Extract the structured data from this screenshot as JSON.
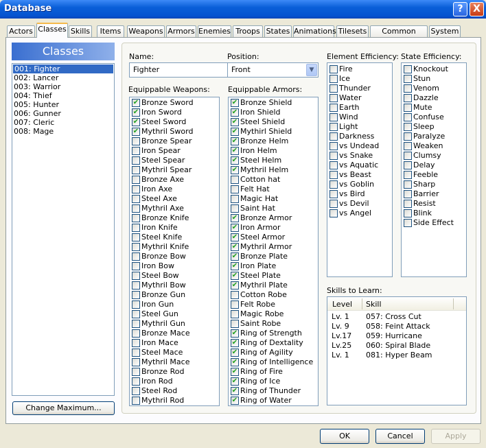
{
  "window": {
    "title": "Database",
    "help": "?",
    "close": "X"
  },
  "tabs": [
    "Actors",
    "Classes",
    "Skills",
    "Items",
    "Weapons",
    "Armors",
    "Enemies",
    "Troops",
    "States",
    "Animations",
    "Tilesets",
    "Common Events",
    "System"
  ],
  "selected_tab": "Classes",
  "classes": {
    "header": "Classes",
    "items": [
      "001: Fighter",
      "002: Lancer",
      "003: Warrior",
      "004: Thief",
      "005: Hunter",
      "006: Gunner",
      "007: Cleric",
      "008: Mage"
    ],
    "selected": 0,
    "change_max": "Change Maximum..."
  },
  "form": {
    "name_label": "Name:",
    "name_value": "Fighter",
    "position_label": "Position:",
    "position_value": "Front",
    "weapons_label": "Equippable Weapons:",
    "armors_label": "Equippable Armors:",
    "element_label": "Element Efficiency:",
    "state_label": "State Efficiency:",
    "skills_label": "Skills to Learn:"
  },
  "weapons": [
    [
      "Bronze Sword",
      true
    ],
    [
      "Iron Sword",
      true
    ],
    [
      "Steel Sword",
      true
    ],
    [
      "Mythril Sword",
      true
    ],
    [
      "Bronze Spear",
      false
    ],
    [
      "Iron Spear",
      false
    ],
    [
      "Steel Spear",
      false
    ],
    [
      "Mythril Spear",
      false
    ],
    [
      "Bronze Axe",
      false
    ],
    [
      "Iron Axe",
      false
    ],
    [
      "Steel Axe",
      false
    ],
    [
      "Mythril Axe",
      false
    ],
    [
      "Bronze Knife",
      false
    ],
    [
      "Iron Knife",
      false
    ],
    [
      "Steel Knife",
      false
    ],
    [
      "Mythril Knife",
      false
    ],
    [
      "Bronze Bow",
      false
    ],
    [
      "Iron Bow",
      false
    ],
    [
      "Steel Bow",
      false
    ],
    [
      "Mythril Bow",
      false
    ],
    [
      "Bronze Gun",
      false
    ],
    [
      "Iron Gun",
      false
    ],
    [
      "Steel Gun",
      false
    ],
    [
      "Mythril Gun",
      false
    ],
    [
      "Bronze Mace",
      false
    ],
    [
      "Iron Mace",
      false
    ],
    [
      "Steel Mace",
      false
    ],
    [
      "Mythril Mace",
      false
    ],
    [
      "Bronze Rod",
      false
    ],
    [
      "Iron Rod",
      false
    ],
    [
      "Steel Rod",
      false
    ],
    [
      "Mythril Rod",
      false
    ]
  ],
  "armors": [
    [
      "Bronze Shield",
      true
    ],
    [
      "Iron Shield",
      true
    ],
    [
      "Steel Shield",
      true
    ],
    [
      "Mythirl Shield",
      true
    ],
    [
      "Bronze Helm",
      true
    ],
    [
      "Iron Helm",
      true
    ],
    [
      "Steel Helm",
      true
    ],
    [
      "Mythril Helm",
      true
    ],
    [
      "Cotton hat",
      false
    ],
    [
      "Felt Hat",
      false
    ],
    [
      "Magic Hat",
      false
    ],
    [
      "Saint Hat",
      false
    ],
    [
      "Bronze Armor",
      true
    ],
    [
      "Iron Armor",
      true
    ],
    [
      "Steel Armor",
      true
    ],
    [
      "Mythril Armor",
      true
    ],
    [
      "Bronze Plate",
      true
    ],
    [
      "Iron Plate",
      true
    ],
    [
      "Steel Plate",
      true
    ],
    [
      "Mythril Plate",
      true
    ],
    [
      "Cotton Robe",
      false
    ],
    [
      "Felt Robe",
      false
    ],
    [
      "Magic Robe",
      false
    ],
    [
      "Saint Robe",
      false
    ],
    [
      "Ring of Strength",
      true
    ],
    [
      "Ring of Dextality",
      true
    ],
    [
      "Ring of Agility",
      true
    ],
    [
      "Ring of Intelligence",
      true
    ],
    [
      "Ring of Fire",
      true
    ],
    [
      "Ring of Ice",
      true
    ],
    [
      "Ring of Thunder",
      true
    ],
    [
      "Ring of Water",
      true
    ]
  ],
  "elements": [
    [
      "Fire",
      false
    ],
    [
      "Ice",
      false
    ],
    [
      "Thunder",
      false
    ],
    [
      "Water",
      false
    ],
    [
      "Earth",
      false
    ],
    [
      "Wind",
      false
    ],
    [
      "Light",
      false
    ],
    [
      "Darkness",
      false
    ],
    [
      "vs Undead",
      false
    ],
    [
      "vs Snake",
      false
    ],
    [
      "vs Aquatic",
      false
    ],
    [
      "vs Beast",
      false
    ],
    [
      "vs Goblin",
      false
    ],
    [
      "vs Bird",
      false
    ],
    [
      "vs Devil",
      false
    ],
    [
      "vs Angel",
      false
    ]
  ],
  "states": [
    [
      "Knockout",
      false
    ],
    [
      "Stun",
      false
    ],
    [
      "Venom",
      false
    ],
    [
      "Dazzle",
      false
    ],
    [
      "Mute",
      false
    ],
    [
      "Confuse",
      false
    ],
    [
      "Sleep",
      false
    ],
    [
      "Paralyze",
      false
    ],
    [
      "Weaken",
      false
    ],
    [
      "Clumsy",
      false
    ],
    [
      "Delay",
      false
    ],
    [
      "Feeble",
      false
    ],
    [
      "Sharp",
      false
    ],
    [
      "Barrier",
      false
    ],
    [
      "Resist",
      false
    ],
    [
      "Blink",
      false
    ],
    [
      "Side Effect",
      false
    ]
  ],
  "skills_table": {
    "columns": [
      "Level",
      "Skill"
    ],
    "rows": [
      [
        "Lv. 1",
        "057: Cross Cut"
      ],
      [
        "Lv. 9",
        "058: Feint Attack"
      ],
      [
        "Lv.17",
        "059: Hurricane"
      ],
      [
        "Lv.25",
        "060: Spiral Blade"
      ],
      [
        "Lv. 1",
        "081: Hyper Beam"
      ]
    ]
  },
  "buttons": {
    "ok": "OK",
    "cancel": "Cancel",
    "apply": "Apply"
  }
}
